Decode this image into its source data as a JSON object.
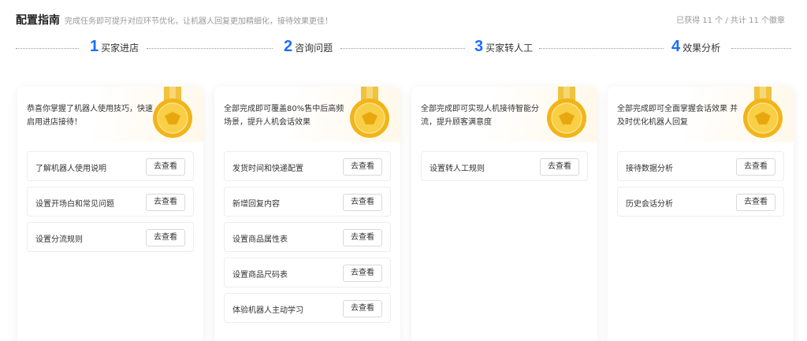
{
  "header": {
    "title": "配置指南",
    "subtitle": "完成任务即可提升对应环节优化，让机器人回复更加精细化，接待效果更佳！",
    "badge_count": "已获得 11 个 / 共计 11 个徽章"
  },
  "steps": [
    {
      "num": "1",
      "label": "买家进店"
    },
    {
      "num": "2",
      "label": "咨询问题"
    },
    {
      "num": "3",
      "label": "买家转人工"
    },
    {
      "num": "4",
      "label": "效果分析"
    }
  ],
  "cards": [
    {
      "desc": "恭喜你掌握了机器人使用技巧，快速启用进店接待！",
      "tasks": [
        {
          "label": "了解机器人使用说明",
          "button": "去查看"
        },
        {
          "label": "设置开场白和常见问题",
          "button": "去查看"
        },
        {
          "label": "设置分流规则",
          "button": "去查看"
        }
      ]
    },
    {
      "desc": "全部完成即可覆盖80%售中后高频场景，提升人机会话效果",
      "tasks": [
        {
          "label": "发货时间和快递配置",
          "button": "去查看"
        },
        {
          "label": "新增回复内容",
          "button": "去查看"
        },
        {
          "label": "设置商品属性表",
          "button": "去查看"
        },
        {
          "label": "设置商品尺码表",
          "button": "去查看"
        },
        {
          "label": "体验机器人主动学习",
          "button": "去查看"
        }
      ]
    },
    {
      "desc": "全部完成即可实现人机接待智能分流，提升顾客满意度",
      "tasks": [
        {
          "label": "设置转人工规则",
          "button": "去查看"
        }
      ]
    },
    {
      "desc": "全部完成即可全面掌握会话效果 并及时优化机器人回复",
      "tasks": [
        {
          "label": "接待数据分析",
          "button": "去查看"
        },
        {
          "label": "历史会话分析",
          "button": "去查看"
        }
      ]
    }
  ],
  "colors": {
    "accent": "#1a6dff",
    "medal": "#f2b418"
  },
  "icons": {
    "medal": "medal-icon"
  }
}
